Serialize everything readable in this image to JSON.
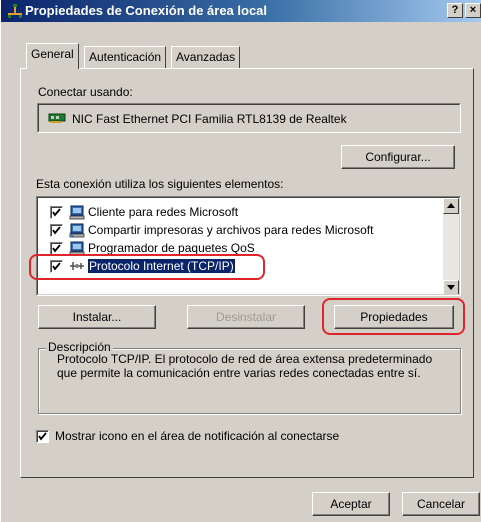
{
  "window": {
    "title": "Propiedades de Conexión de área local",
    "help_button": "?",
    "close_button": "×"
  },
  "tabs": [
    {
      "label": "General",
      "active": true
    },
    {
      "label": "Autenticación",
      "active": false
    },
    {
      "label": "Avanzadas",
      "active": false
    }
  ],
  "general": {
    "connect_using_label": "Conectar usando:",
    "adapter_name": "NIC Fast Ethernet PCI Familia RTL8139 de Realtek",
    "configure_button": "Configurar...",
    "components_label": "Esta conexión utiliza los siguientes elementos:",
    "components": [
      {
        "label": "Cliente para redes Microsoft",
        "checked": true,
        "icon": "network-client-icon",
        "selected": false
      },
      {
        "label": "Compartir impresoras y archivos para redes Microsoft",
        "checked": true,
        "icon": "file-printer-sharing-icon",
        "selected": false
      },
      {
        "label": "Programador de paquetes QoS",
        "checked": true,
        "icon": "qos-scheduler-icon",
        "selected": false
      },
      {
        "label": "Protocolo Internet (TCP/IP)",
        "checked": true,
        "icon": "protocol-icon",
        "selected": true
      }
    ],
    "install_button": "Instalar...",
    "uninstall_button": "Desinstalar",
    "properties_button": "Propiedades",
    "description_title": "Descripción",
    "description_text": "Protocolo TCP/IP. El protocolo de red de área extensa predeterminado que permite la comunicación entre varias redes conectadas entre sí.",
    "show_icon_checkbox": {
      "label": "Mostrar icono en el área de notificación al conectarse",
      "checked": true
    }
  },
  "footer": {
    "accept_button": "Aceptar",
    "cancel_button": "Cancelar"
  },
  "colors": {
    "titlebar_start": "#0a246a",
    "titlebar_end": "#a6caf0",
    "dialog_face": "#d4d0c8",
    "selection": "#0a246a",
    "annotation_red": "#e0242c"
  }
}
